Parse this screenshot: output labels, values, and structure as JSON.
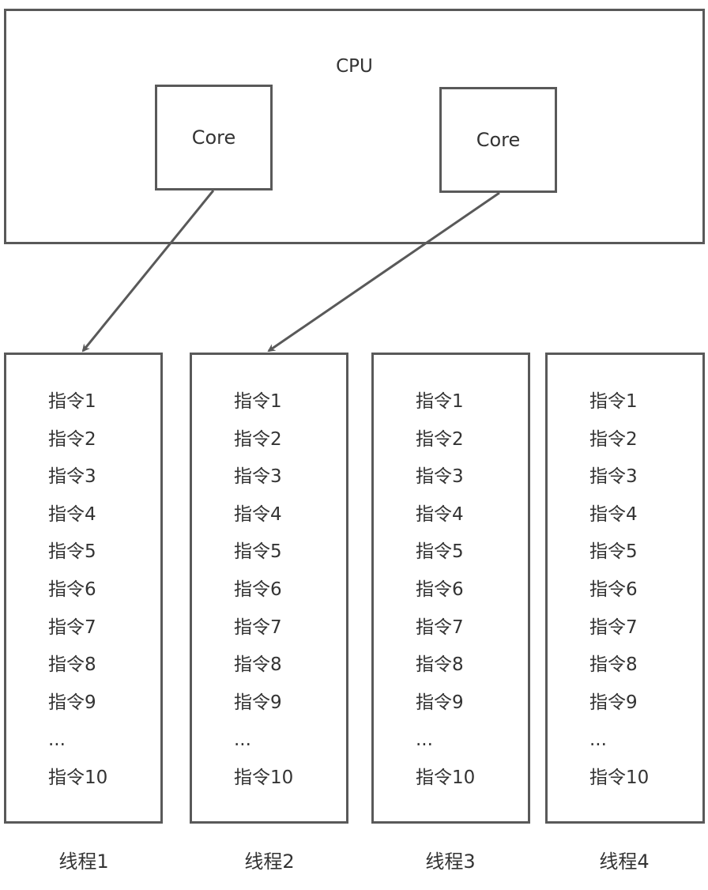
{
  "cpu": {
    "label": "CPU",
    "cores": [
      {
        "label": "Core",
        "target_thread": 1
      },
      {
        "label": "Core",
        "target_thread": 2
      }
    ]
  },
  "threads": [
    {
      "label": "线程1",
      "instructions": [
        "指令1",
        "指令2",
        "指令3",
        "指令4",
        "指令5",
        "指令6",
        "指令7",
        "指令8",
        "指令9",
        "...",
        "指令10"
      ]
    },
    {
      "label": "线程2",
      "instructions": [
        "指令1",
        "指令2",
        "指令3",
        "指令4",
        "指令5",
        "指令6",
        "指令7",
        "指令8",
        "指令9",
        "...",
        "指令10"
      ]
    },
    {
      "label": "线程3",
      "instructions": [
        "指令1",
        "指令2",
        "指令3",
        "指令4",
        "指令5",
        "指令6",
        "指令7",
        "指令8",
        "指令9",
        "...",
        "指令10"
      ]
    },
    {
      "label": "线程4",
      "instructions": [
        "指令1",
        "指令2",
        "指令3",
        "指令4",
        "指令5",
        "指令6",
        "指令7",
        "指令8",
        "指令9",
        "...",
        "指令10"
      ]
    }
  ],
  "colors": {
    "stroke": "#595959",
    "text": "#333333",
    "background": "#ffffff"
  }
}
